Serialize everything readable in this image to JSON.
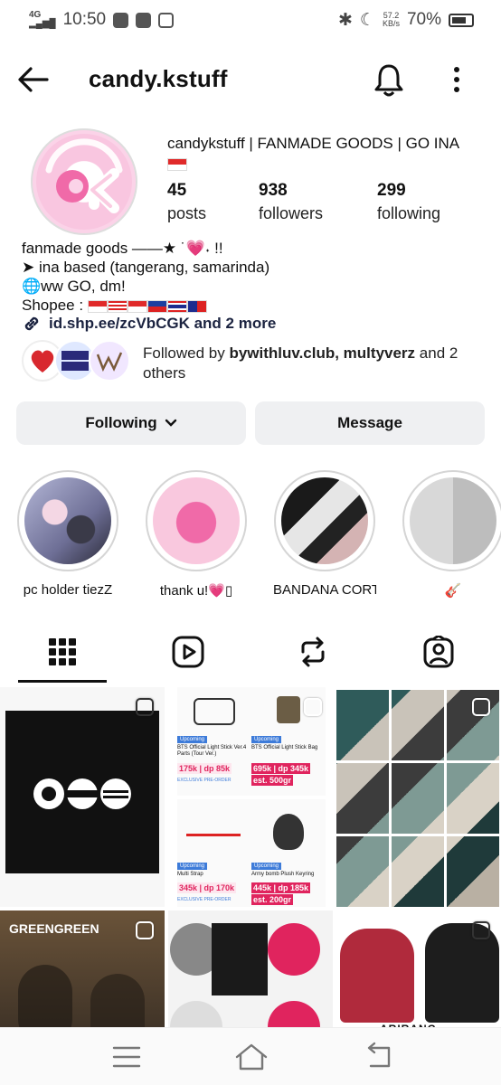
{
  "status_bar": {
    "network": "4G",
    "time": "10:50",
    "speed_value": "57.2",
    "speed_unit": "KB/s",
    "battery": "70%"
  },
  "header": {
    "username": "candy.kstuff"
  },
  "profile": {
    "display_name": "candykstuff | FANMADE GOODS | GO INA",
    "stats": [
      {
        "value": "45",
        "label": "posts"
      },
      {
        "value": "938",
        "label": "followers"
      },
      {
        "value": "299",
        "label": "following"
      }
    ],
    "bio_lines": [
      "fanmade goods ——★ ˙💗˖ !!",
      "➤ ina based (tangerang, samarinda)",
      "🌐ww GO, dm!",
      "Shopee :"
    ],
    "link_text": "id.shp.ee/zcVbCGK and 2 more",
    "followed_by_prefix": "Followed by ",
    "followed_by_names": "bywithluv.club, multyverz",
    "followed_by_suffix": " and 2 others"
  },
  "buttons": {
    "following": "Following",
    "message": "Message"
  },
  "highlights": [
    {
      "label": "pc holder tiezZ"
    },
    {
      "label": "thank u!💗▯"
    },
    {
      "label": "BANDANA CORTI..."
    },
    {
      "label": "🎸"
    }
  ],
  "tabs": [
    {
      "icon": "grid-icon"
    },
    {
      "icon": "reels-icon"
    },
    {
      "icon": "reposts-icon"
    },
    {
      "icon": "tagged-icon"
    }
  ],
  "grid_posts": {
    "post2": {
      "items": [
        {
          "tag": "Upcoming",
          "title": "BTS Official Light Stick Ver.4 Parts (Tour Ver.)",
          "price": "175k | dp 85k",
          "badges": "EXCLUSIVE  PRE-ORDER"
        },
        {
          "tag": "Upcoming",
          "title": "BTS Official Light Stick Bag",
          "price": "695k | dp 345k",
          "extra": "est. 500gr"
        },
        {
          "tag": "Upcoming",
          "title": "Multi Strap",
          "price": "345k | dp 170k",
          "badges": "EXCLUSIVE  PRE-ORDER"
        },
        {
          "tag": "Upcoming",
          "title": "Army bomb Plush Keyring",
          "price": "445k | dp 185k",
          "extra": "est. 200gr"
        }
      ]
    },
    "post4_text": "GREENGREEN",
    "post6_text": "ARIRANG"
  },
  "colors": {
    "accent_pink": "#f06aa8",
    "price_red": "#e0245e",
    "upcoming_blue": "#3d7bd9"
  }
}
